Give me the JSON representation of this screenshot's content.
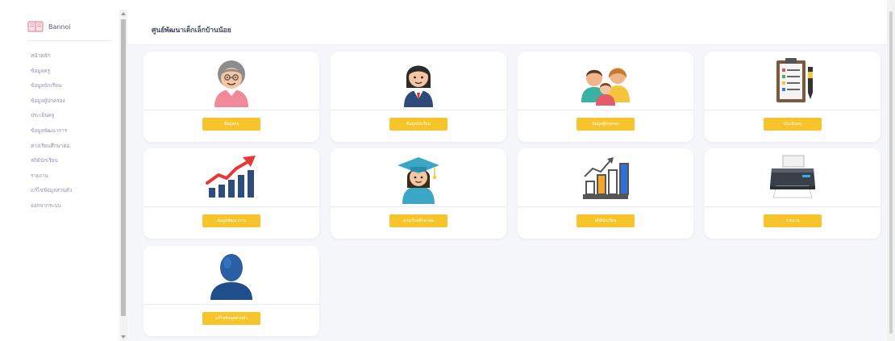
{
  "brand": {
    "name": "Bannoi",
    "icon": "open-book-icon"
  },
  "sidebar": {
    "items": [
      "หน้าหลัก",
      "ข้อมูลครู",
      "ข้อมูลนักเรียน",
      "ข้อมูลผู้ปกครอง",
      "ประเมินครู",
      "ข้อมูลพัฒนาการ",
      "ทางเรียนศึกษาต่อ",
      "สถิตินักเรียน",
      "รายงาน",
      "แก้ไขข้อมูลส่วนตัว",
      "ออกจากระบบ"
    ]
  },
  "header": {
    "title": "ศูนย์พัฒนาเด็กเล็กบ้านน้อย"
  },
  "cards": [
    {
      "icon": "elderly-woman-teacher-icon",
      "button": "ข้อมูลครู"
    },
    {
      "icon": "student-girl-icon",
      "button": "ข้อมูลนักเรียน"
    },
    {
      "icon": "family-parents-icon",
      "button": "ข้อมูลผู้ปกครอง"
    },
    {
      "icon": "clipboard-checklist-icon",
      "button": "ประเมินครู"
    },
    {
      "icon": "growth-chart-arrow-icon",
      "button": "ข้อมูลพัฒนาการ"
    },
    {
      "icon": "graduate-student-icon",
      "button": "ทางเรียนศึกษาต่อ"
    },
    {
      "icon": "bar-chart-statistics-icon",
      "button": "สถิตินักเรียน"
    },
    {
      "icon": "printer-icon",
      "button": "รายงาน"
    },
    {
      "icon": "user-profile-icon",
      "button": "แก้ไขข้อมูลส่วนตัว"
    }
  ],
  "colors": {
    "accent": "#f7c52b",
    "background": "#f6f7fb",
    "card": "#ffffff",
    "nav_text": "#8e93b4"
  }
}
